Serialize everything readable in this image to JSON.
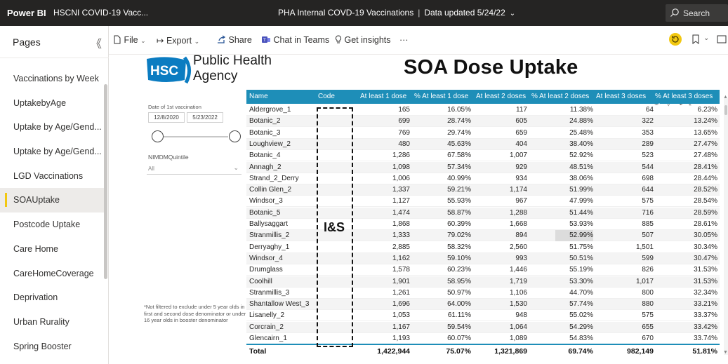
{
  "app": {
    "brand": "Power BI",
    "report_name": "HSCNI COVID-19 Vacc...",
    "center_title": "PHA Internal COVD-19 Vaccinations",
    "data_updated": "Data updated 5/24/22",
    "search_placeholder": "Search"
  },
  "pages_panel": {
    "header": "Pages",
    "items": [
      "Vaccinations by Week",
      "UptakebyAge",
      "Uptake by Age/Gend...",
      "Uptake by Age/Gend...",
      "LGD Vaccinations",
      "SOAUptake",
      "Postcode Uptake",
      "Care Home",
      "CareHomeCoverage",
      "Deprivation",
      "Urban Rurality",
      "Spring Booster"
    ],
    "active_index": 5
  },
  "toolbar": {
    "file": "File",
    "export": "Export",
    "share": "Share",
    "chat": "Chat in Teams",
    "insights": "Get insights",
    "more": "···"
  },
  "report": {
    "logo_text": "HSC",
    "org_line1": "Public Health",
    "org_line2": "Agency",
    "title": "SOA Dose Uptake",
    "slicer_label": "Date of 1st vaccination",
    "date_from": "12/8/2020",
    "date_to": "5/23/2022",
    "nimdm_label": "NIMDMQuintile",
    "nimdm_value": "All",
    "footnote": "*Not filtered to exclude under 5 year olds in first and second dose denominator or under 16 year olds in booster denominator",
    "code_overlay": "I&S"
  },
  "table": {
    "columns": [
      "Name",
      "Code",
      "At least 1 dose",
      "% At least 1 dose",
      "At least 2 doses",
      "% At least 2 doses",
      "At least 3 doses",
      "% At least 3 doses"
    ],
    "rows": [
      [
        "Aldergrove_1",
        "165",
        "16.05%",
        "117",
        "11.38%",
        "64",
        "6.23%"
      ],
      [
        "Botanic_2",
        "699",
        "28.74%",
        "605",
        "24.88%",
        "322",
        "13.24%"
      ],
      [
        "Botanic_3",
        "769",
        "29.74%",
        "659",
        "25.48%",
        "353",
        "13.65%"
      ],
      [
        "Loughview_2",
        "480",
        "45.63%",
        "404",
        "38.40%",
        "289",
        "27.47%"
      ],
      [
        "Botanic_4",
        "1,286",
        "67.58%",
        "1,007",
        "52.92%",
        "523",
        "27.48%"
      ],
      [
        "Annagh_2",
        "1,098",
        "57.34%",
        "929",
        "48.51%",
        "544",
        "28.41%"
      ],
      [
        "Strand_2_Derry",
        "1,006",
        "40.99%",
        "934",
        "38.06%",
        "698",
        "28.44%"
      ],
      [
        "Collin Glen_2",
        "1,337",
        "59.21%",
        "1,174",
        "51.99%",
        "644",
        "28.52%"
      ],
      [
        "Windsor_3",
        "1,127",
        "55.93%",
        "967",
        "47.99%",
        "575",
        "28.54%"
      ],
      [
        "Botanic_5",
        "1,474",
        "58.87%",
        "1,288",
        "51.44%",
        "716",
        "28.59%"
      ],
      [
        "Ballysaggart",
        "1,868",
        "60.39%",
        "1,668",
        "53.93%",
        "885",
        "28.61%"
      ],
      [
        "Stranmillis_2",
        "1,333",
        "79.02%",
        "894",
        "52.99%",
        "507",
        "30.05%"
      ],
      [
        "Derryaghy_1",
        "2,885",
        "58.32%",
        "2,560",
        "51.75%",
        "1,501",
        "30.34%"
      ],
      [
        "Windsor_4",
        "1,162",
        "59.10%",
        "993",
        "50.51%",
        "599",
        "30.47%"
      ],
      [
        "Drumglass",
        "1,578",
        "60.23%",
        "1,446",
        "55.19%",
        "826",
        "31.53%"
      ],
      [
        "Coolhill",
        "1,901",
        "58.95%",
        "1,719",
        "53.30%",
        "1,017",
        "31.53%"
      ],
      [
        "Stranmillis_3",
        "1,261",
        "50.97%",
        "1,106",
        "44.70%",
        "800",
        "32.34%"
      ],
      [
        "Shantallow West_3",
        "1,696",
        "64.00%",
        "1,530",
        "57.74%",
        "880",
        "33.21%"
      ],
      [
        "Lisanelly_2",
        "1,053",
        "61.11%",
        "948",
        "55.02%",
        "575",
        "33.37%"
      ],
      [
        "Corcrain_2",
        "1,167",
        "59.54%",
        "1,064",
        "54.29%",
        "655",
        "33.42%"
      ],
      [
        "Glencairn_1",
        "1,193",
        "60.07%",
        "1,089",
        "54.83%",
        "670",
        "33.74%"
      ]
    ],
    "highlight_cell": [
      11,
      4
    ],
    "total": [
      "Total",
      "1,422,944",
      "75.07%",
      "1,321,869",
      "69.74%",
      "982,149",
      "51.81%"
    ]
  }
}
